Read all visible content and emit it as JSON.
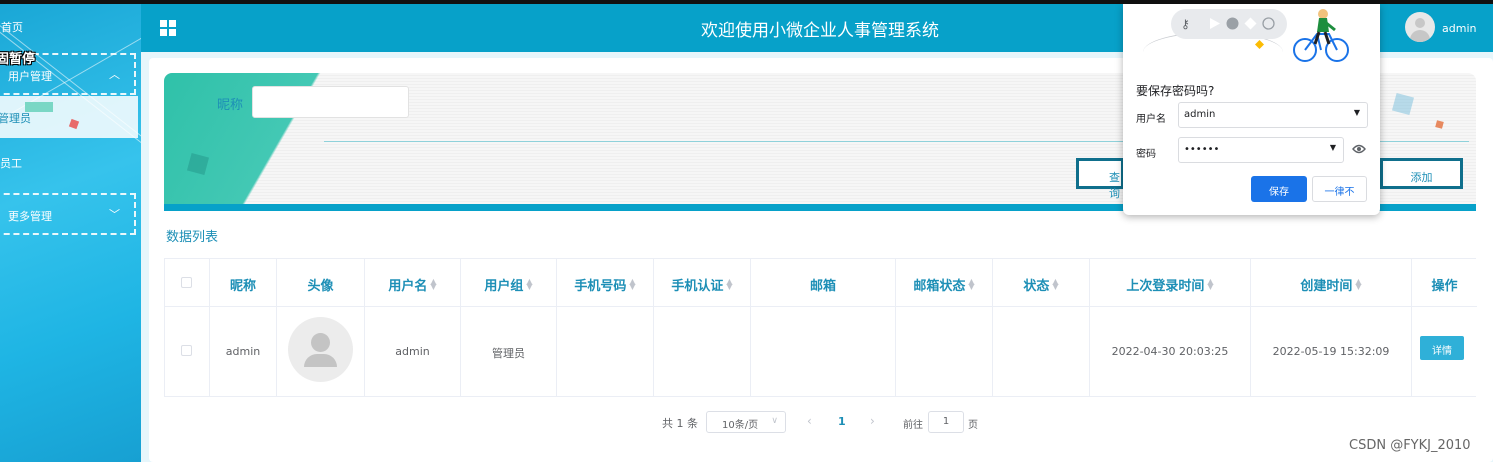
{
  "header": {
    "title": "欢迎使用小微企业人事管理系统",
    "username": "admin"
  },
  "sidebar": {
    "home": "首页",
    "overlay_tooltip": "固暂停",
    "user_management": "用户管理",
    "admin_sub": "管理员",
    "staff_sub": "员工",
    "more_management": "更多管理"
  },
  "search": {
    "nickname_label": "昵称",
    "nickname_value": "",
    "query_button": "查询",
    "add_button": "添加"
  },
  "list": {
    "title": "数据列表",
    "columns": [
      "昵称",
      "头像",
      "用户名",
      "用户组",
      "手机号码",
      "手机认证",
      "邮箱",
      "邮箱状态",
      "状态",
      "上次登录时间",
      "创建时间",
      "操作"
    ],
    "rows": [
      {
        "nickname": "admin",
        "username": "admin",
        "group": "管理员",
        "phone": "",
        "phone_verified": "",
        "email": "",
        "email_status": "",
        "status": "",
        "last_login": "2022-04-30 20:03:25",
        "created": "2022-05-19 15:32:09",
        "action": "详情"
      }
    ]
  },
  "pagination": {
    "total": "共 1 条",
    "page_size": "10条/页",
    "current_page": "1",
    "goto_label": "前往",
    "goto_value": "1",
    "page_label": "页"
  },
  "password_popup": {
    "title": "要保存密码吗?",
    "username_label": "用户名",
    "username_value": "admin",
    "password_label": "密码",
    "password_value": "••••••",
    "save_button": "保存",
    "never_button": "一律不"
  },
  "watermark": "CSDN @FYKJ_2010",
  "colors": {
    "header": "#07a1c9",
    "accent": "#1d8fb6",
    "banner_teal": "#2ebfa8",
    "chrome_blue": "#1a73e8"
  }
}
